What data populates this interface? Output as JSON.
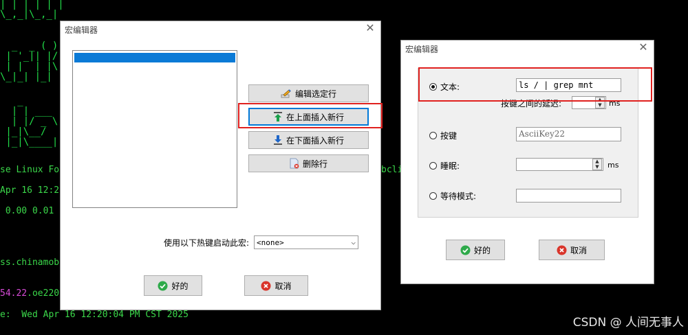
{
  "terminal": {
    "line_os": "se Linux Fo",
    "line_os_tail": "bcli",
    "line_date_part": "Apr 16 12:2",
    "line_load": " 0.00 0.01",
    "line_domain": "ss.chinamob",
    "line_ip_mag": "54.22",
    "line_ip_rest": ".oe220",
    "line_time": "e:  Wed Apr 16 12:20:04 PM CST 2025",
    "ascii_rows": [
      "| | | | | |",
      "\\_,_|\\_,_|",
      "  _  _ ( )",
      " | '_|| |/",
      " | |  | |\\",
      "\\_|_| |_|",
      "   _",
      "  | | ___",
      "  | |/ _ \\",
      " |_|\\__/",
      " |_|\\____|"
    ]
  },
  "dialog_left": {
    "title": "宏编辑器",
    "btn_edit": "编辑选定行",
    "btn_insert_above": "在上面插入新行",
    "btn_insert_below": "在下面插入新行",
    "btn_delete": "删除行",
    "hotkey_label": "使用以下热键启动此宏:",
    "hotkey_value": "<none>",
    "ok": "好的",
    "cancel": "取消"
  },
  "dialog_right": {
    "title": "宏编辑器",
    "opt_text": "文本:",
    "text_value": "ls / | grep mnt",
    "delay_label": "按键之间的延迟:",
    "delay_unit": "ms",
    "opt_key": "按键",
    "key_value": "AsciiKey22",
    "opt_sleep": "睡眠:",
    "sleep_unit": "ms",
    "opt_wait": "等待模式:",
    "ok": "好的",
    "cancel": "取消"
  },
  "watermark": "CSDN @ 人间无事人",
  "colors": {
    "terminal_green": "#3bd84a",
    "selection_blue": "#0a7ad6",
    "highlight_red": "#e0201e",
    "ok_green": "#2eaa4a",
    "cancel_red": "#d9352b"
  }
}
